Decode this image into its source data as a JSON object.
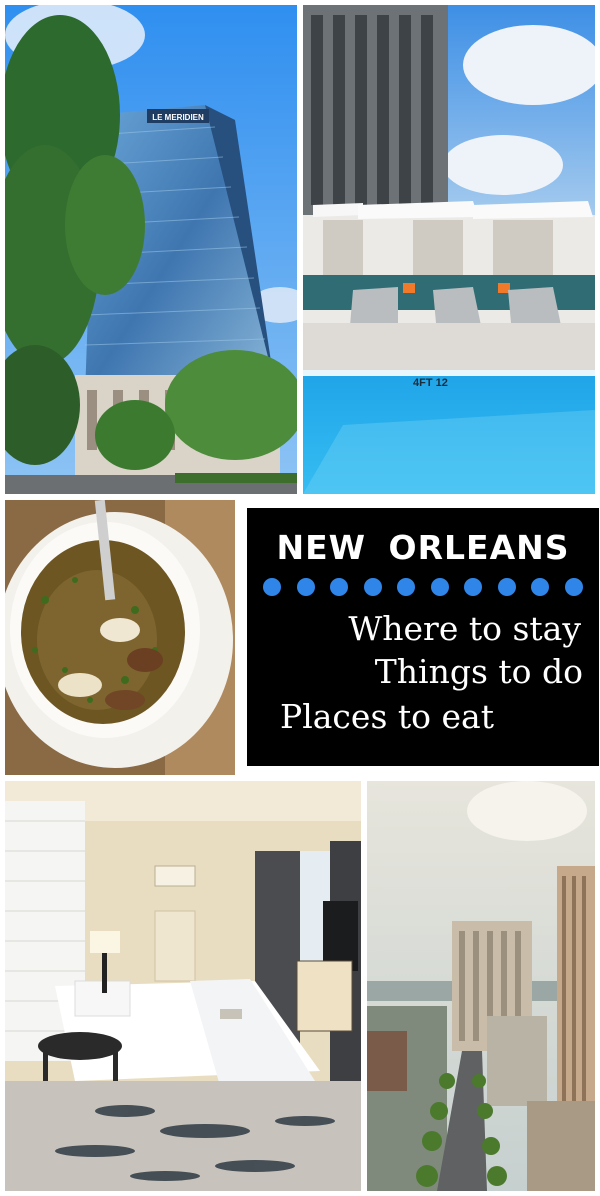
{
  "title_card": {
    "heading": "NEW ORLEANS",
    "dot_color": "#2f86e8",
    "dot_count": 10,
    "lines": [
      "Where to stay",
      "Things to do",
      "Places to eat"
    ]
  },
  "photos": {
    "hotel_sign": "LE MERIDIEN",
    "pool_marker": "4FT 12"
  }
}
